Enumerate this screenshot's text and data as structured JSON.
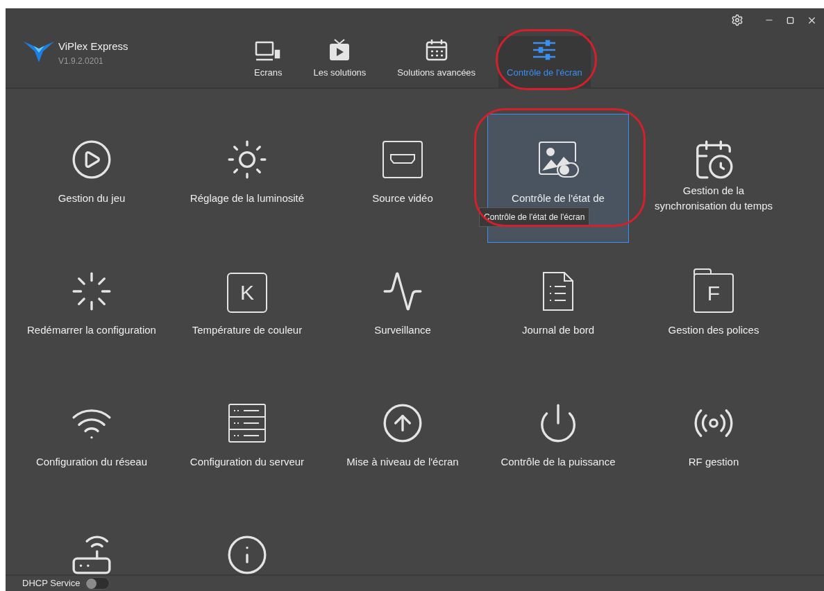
{
  "app": {
    "name": "ViPlex Express",
    "version": "V1.9.2.0201"
  },
  "tabs": [
    {
      "label": "Ecrans",
      "selected": false
    },
    {
      "label": "Les solutions",
      "selected": false
    },
    {
      "label": "Solutions avancées",
      "selected": false
    },
    {
      "label": "Contrôle de l'écran",
      "selected": true
    }
  ],
  "tiles": [
    {
      "label": "Gestion du jeu",
      "selected": false
    },
    {
      "label": "Réglage de la luminosité",
      "selected": false
    },
    {
      "label": "Source vidéo",
      "selected": false
    },
    {
      "label": "Contrôle de l'état de",
      "selected": true,
      "tooltip": "Contrôle de l'état de l'écran"
    },
    {
      "label": "Gestion de la synchronisation du temps",
      "selected": false
    },
    {
      "label": "Redémarrer la configuration",
      "selected": false
    },
    {
      "label": "Température de couleur",
      "selected": false,
      "icon_letter": "K"
    },
    {
      "label": "Surveillance",
      "selected": false
    },
    {
      "label": "Journal de bord",
      "selected": false
    },
    {
      "label": "Gestion des polices",
      "selected": false,
      "icon_letter": "F"
    },
    {
      "label": "Configuration du réseau",
      "selected": false
    },
    {
      "label": "Configuration du serveur",
      "selected": false
    },
    {
      "label": "Mise à niveau de l'écran",
      "selected": false
    },
    {
      "label": "Contrôle de la puissance",
      "selected": false
    },
    {
      "label": "RF gestion",
      "selected": false
    },
    {
      "selected": false
    },
    {
      "selected": false
    }
  ],
  "status_bar": {
    "label": "DHCP Service",
    "on": false
  }
}
